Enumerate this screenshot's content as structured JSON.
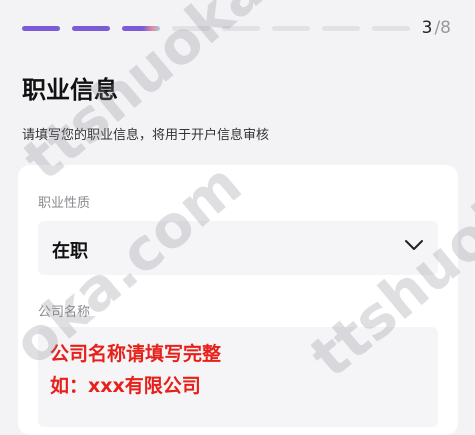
{
  "progress": {
    "current": 3,
    "total": 8,
    "step_current": "3",
    "step_sep": "/8"
  },
  "header": {
    "title": "职业信息",
    "subtitle": "请填写您的职业信息，将用于开户信息审核"
  },
  "form": {
    "occupation": {
      "label": "职业性质",
      "value": "在职"
    },
    "company": {
      "label": "公司名称",
      "hint_line1": "公司名称请填写完整",
      "hint_line2": "如：xxx有限公司"
    }
  },
  "watermarks": [
    "ttshuoka.com",
    "oka.com",
    "ttshuok"
  ],
  "colors": {
    "accent": "#7b5bd6",
    "hint": "#e8201a"
  }
}
